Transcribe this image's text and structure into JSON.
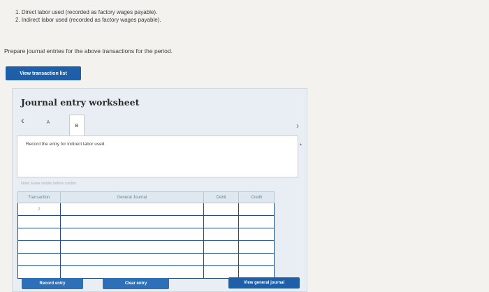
{
  "instructions": [
    "1. Direct labor used (recorded as factory wages payable).",
    "2. Indirect labor used (recorded as factory wages payable)."
  ],
  "prompt": "Prepare journal entries for the above transactions for the period.",
  "view_transaction_list_label": "View transaction list",
  "worksheet": {
    "title": "Journal entry worksheet",
    "tabs": [
      "A",
      "B"
    ],
    "active_tab": "B",
    "description": "Record the entry for indirect labor used.",
    "note": "Note: Enter debits before credits.",
    "table": {
      "headers": [
        "Transaction",
        "General Journal",
        "Debit",
        "Credit"
      ],
      "rows": [
        [
          "2",
          "",
          "",
          ""
        ],
        [
          "",
          "",
          "",
          ""
        ],
        [
          "",
          "",
          "",
          ""
        ],
        [
          "",
          "",
          "",
          ""
        ],
        [
          "",
          "",
          "",
          ""
        ],
        [
          "",
          "",
          "",
          ""
        ]
      ]
    },
    "buttons": {
      "record": "Record entry",
      "clear": "Clear entry"
    }
  },
  "view_general_journal_label": "View general journal",
  "colors": {
    "primary_button": "#1f5fa7",
    "table_border": "#1d4f86"
  }
}
